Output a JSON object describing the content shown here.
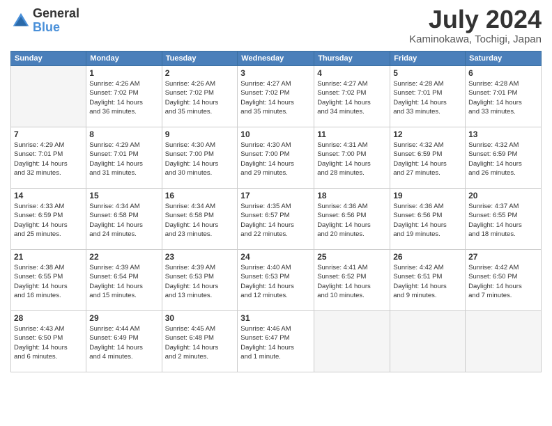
{
  "logo": {
    "general": "General",
    "blue": "Blue"
  },
  "title": {
    "month": "July 2024",
    "location": "Kaminokawa, Tochigi, Japan"
  },
  "weekdays": [
    "Sunday",
    "Monday",
    "Tuesday",
    "Wednesday",
    "Thursday",
    "Friday",
    "Saturday"
  ],
  "weeks": [
    [
      {
        "day": null,
        "info": null
      },
      {
        "day": "1",
        "info": "Sunrise: 4:26 AM\nSunset: 7:02 PM\nDaylight: 14 hours\nand 36 minutes."
      },
      {
        "day": "2",
        "info": "Sunrise: 4:26 AM\nSunset: 7:02 PM\nDaylight: 14 hours\nand 35 minutes."
      },
      {
        "day": "3",
        "info": "Sunrise: 4:27 AM\nSunset: 7:02 PM\nDaylight: 14 hours\nand 35 minutes."
      },
      {
        "day": "4",
        "info": "Sunrise: 4:27 AM\nSunset: 7:02 PM\nDaylight: 14 hours\nand 34 minutes."
      },
      {
        "day": "5",
        "info": "Sunrise: 4:28 AM\nSunset: 7:01 PM\nDaylight: 14 hours\nand 33 minutes."
      },
      {
        "day": "6",
        "info": "Sunrise: 4:28 AM\nSunset: 7:01 PM\nDaylight: 14 hours\nand 33 minutes."
      }
    ],
    [
      {
        "day": "7",
        "info": "Sunrise: 4:29 AM\nSunset: 7:01 PM\nDaylight: 14 hours\nand 32 minutes."
      },
      {
        "day": "8",
        "info": "Sunrise: 4:29 AM\nSunset: 7:01 PM\nDaylight: 14 hours\nand 31 minutes."
      },
      {
        "day": "9",
        "info": "Sunrise: 4:30 AM\nSunset: 7:00 PM\nDaylight: 14 hours\nand 30 minutes."
      },
      {
        "day": "10",
        "info": "Sunrise: 4:30 AM\nSunset: 7:00 PM\nDaylight: 14 hours\nand 29 minutes."
      },
      {
        "day": "11",
        "info": "Sunrise: 4:31 AM\nSunset: 7:00 PM\nDaylight: 14 hours\nand 28 minutes."
      },
      {
        "day": "12",
        "info": "Sunrise: 4:32 AM\nSunset: 6:59 PM\nDaylight: 14 hours\nand 27 minutes."
      },
      {
        "day": "13",
        "info": "Sunrise: 4:32 AM\nSunset: 6:59 PM\nDaylight: 14 hours\nand 26 minutes."
      }
    ],
    [
      {
        "day": "14",
        "info": "Sunrise: 4:33 AM\nSunset: 6:59 PM\nDaylight: 14 hours\nand 25 minutes."
      },
      {
        "day": "15",
        "info": "Sunrise: 4:34 AM\nSunset: 6:58 PM\nDaylight: 14 hours\nand 24 minutes."
      },
      {
        "day": "16",
        "info": "Sunrise: 4:34 AM\nSunset: 6:58 PM\nDaylight: 14 hours\nand 23 minutes."
      },
      {
        "day": "17",
        "info": "Sunrise: 4:35 AM\nSunset: 6:57 PM\nDaylight: 14 hours\nand 22 minutes."
      },
      {
        "day": "18",
        "info": "Sunrise: 4:36 AM\nSunset: 6:56 PM\nDaylight: 14 hours\nand 20 minutes."
      },
      {
        "day": "19",
        "info": "Sunrise: 4:36 AM\nSunset: 6:56 PM\nDaylight: 14 hours\nand 19 minutes."
      },
      {
        "day": "20",
        "info": "Sunrise: 4:37 AM\nSunset: 6:55 PM\nDaylight: 14 hours\nand 18 minutes."
      }
    ],
    [
      {
        "day": "21",
        "info": "Sunrise: 4:38 AM\nSunset: 6:55 PM\nDaylight: 14 hours\nand 16 minutes."
      },
      {
        "day": "22",
        "info": "Sunrise: 4:39 AM\nSunset: 6:54 PM\nDaylight: 14 hours\nand 15 minutes."
      },
      {
        "day": "23",
        "info": "Sunrise: 4:39 AM\nSunset: 6:53 PM\nDaylight: 14 hours\nand 13 minutes."
      },
      {
        "day": "24",
        "info": "Sunrise: 4:40 AM\nSunset: 6:53 PM\nDaylight: 14 hours\nand 12 minutes."
      },
      {
        "day": "25",
        "info": "Sunrise: 4:41 AM\nSunset: 6:52 PM\nDaylight: 14 hours\nand 10 minutes."
      },
      {
        "day": "26",
        "info": "Sunrise: 4:42 AM\nSunset: 6:51 PM\nDaylight: 14 hours\nand 9 minutes."
      },
      {
        "day": "27",
        "info": "Sunrise: 4:42 AM\nSunset: 6:50 PM\nDaylight: 14 hours\nand 7 minutes."
      }
    ],
    [
      {
        "day": "28",
        "info": "Sunrise: 4:43 AM\nSunset: 6:50 PM\nDaylight: 14 hours\nand 6 minutes."
      },
      {
        "day": "29",
        "info": "Sunrise: 4:44 AM\nSunset: 6:49 PM\nDaylight: 14 hours\nand 4 minutes."
      },
      {
        "day": "30",
        "info": "Sunrise: 4:45 AM\nSunset: 6:48 PM\nDaylight: 14 hours\nand 2 minutes."
      },
      {
        "day": "31",
        "info": "Sunrise: 4:46 AM\nSunset: 6:47 PM\nDaylight: 14 hours\nand 1 minute."
      },
      {
        "day": null,
        "info": null
      },
      {
        "day": null,
        "info": null
      },
      {
        "day": null,
        "info": null
      }
    ]
  ]
}
